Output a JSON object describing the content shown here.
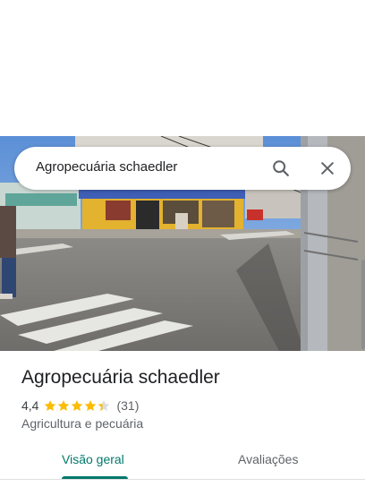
{
  "search": {
    "query": "Agropecuária schaedler",
    "search_icon": "search-icon",
    "close_icon": "close-icon"
  },
  "place": {
    "photo_icon": "street-photo",
    "name": "Agropecuária schaedler",
    "rating": "4,4",
    "stars": 4.4,
    "review_count": "(31)",
    "category": "Agricultura e pecuária"
  },
  "tabs": [
    {
      "label": "Visão geral",
      "selected": true
    },
    {
      "label": "Avaliações",
      "selected": false
    }
  ],
  "colors": {
    "accent": "#00796b",
    "star": "#fbbc04",
    "star_empty": "#dadce0",
    "text_primary": "#202124",
    "text_secondary": "#5f6368"
  }
}
